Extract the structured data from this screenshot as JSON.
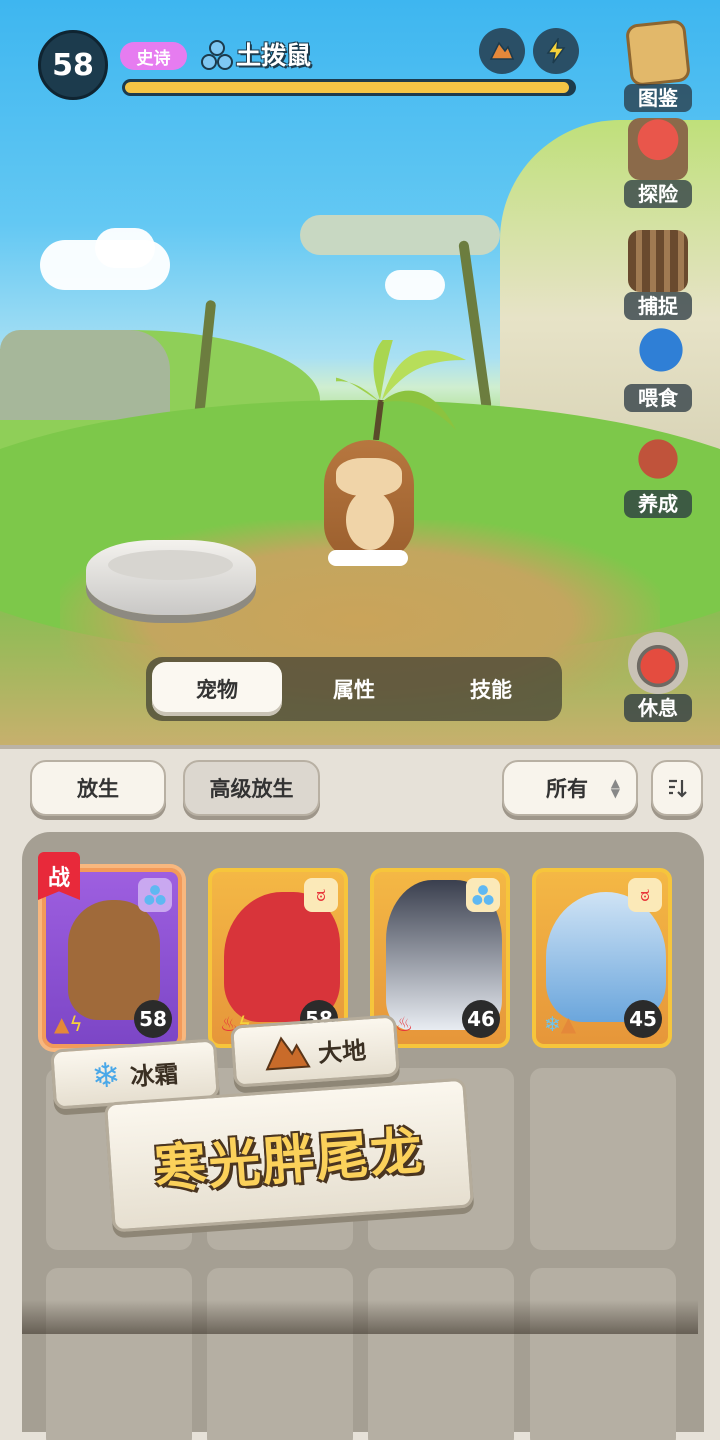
{
  "header": {
    "level": "58",
    "rarity": "史诗",
    "pet_name": "土拨鼠",
    "xp_fraction": 0.99
  },
  "side_menu": [
    {
      "label": "图鉴",
      "icon": "encyclopedia-icon"
    },
    {
      "label": "探险",
      "icon": "explore-icon"
    },
    {
      "label": "捕捉",
      "icon": "cage-icon"
    },
    {
      "label": "喂食",
      "icon": "feed-icon"
    },
    {
      "label": "养成",
      "icon": "training-icon"
    },
    {
      "label": "休息",
      "icon": "rest-icon"
    }
  ],
  "tabs": [
    {
      "label": "宠物",
      "active": true
    },
    {
      "label": "属性",
      "active": false
    },
    {
      "label": "技能",
      "active": false
    }
  ],
  "toolbar": {
    "release": "放生",
    "advanced_release": "高级放生",
    "filter": "所有"
  },
  "pets": [
    {
      "level": "58",
      "battle_tag": "战",
      "types": [
        "earth",
        "electric"
      ],
      "element": "wind"
    },
    {
      "level": "58",
      "types": [
        "fire",
        "electric"
      ],
      "element": "beast"
    },
    {
      "level": "46",
      "types": [
        "electric",
        "fire"
      ],
      "element": "wind"
    },
    {
      "level": "45",
      "types": [
        "ice",
        "earth"
      ],
      "element": "beast"
    }
  ],
  "tooltip": {
    "type1": "冰霜",
    "type2": "大地",
    "pet_name": "寒光胖尾龙"
  },
  "colors": {
    "sky": "#3eb6f0",
    "accent_gold": "#f6c53c",
    "rarity_purple": "#e67cf0",
    "battle_red": "#e8293a"
  }
}
